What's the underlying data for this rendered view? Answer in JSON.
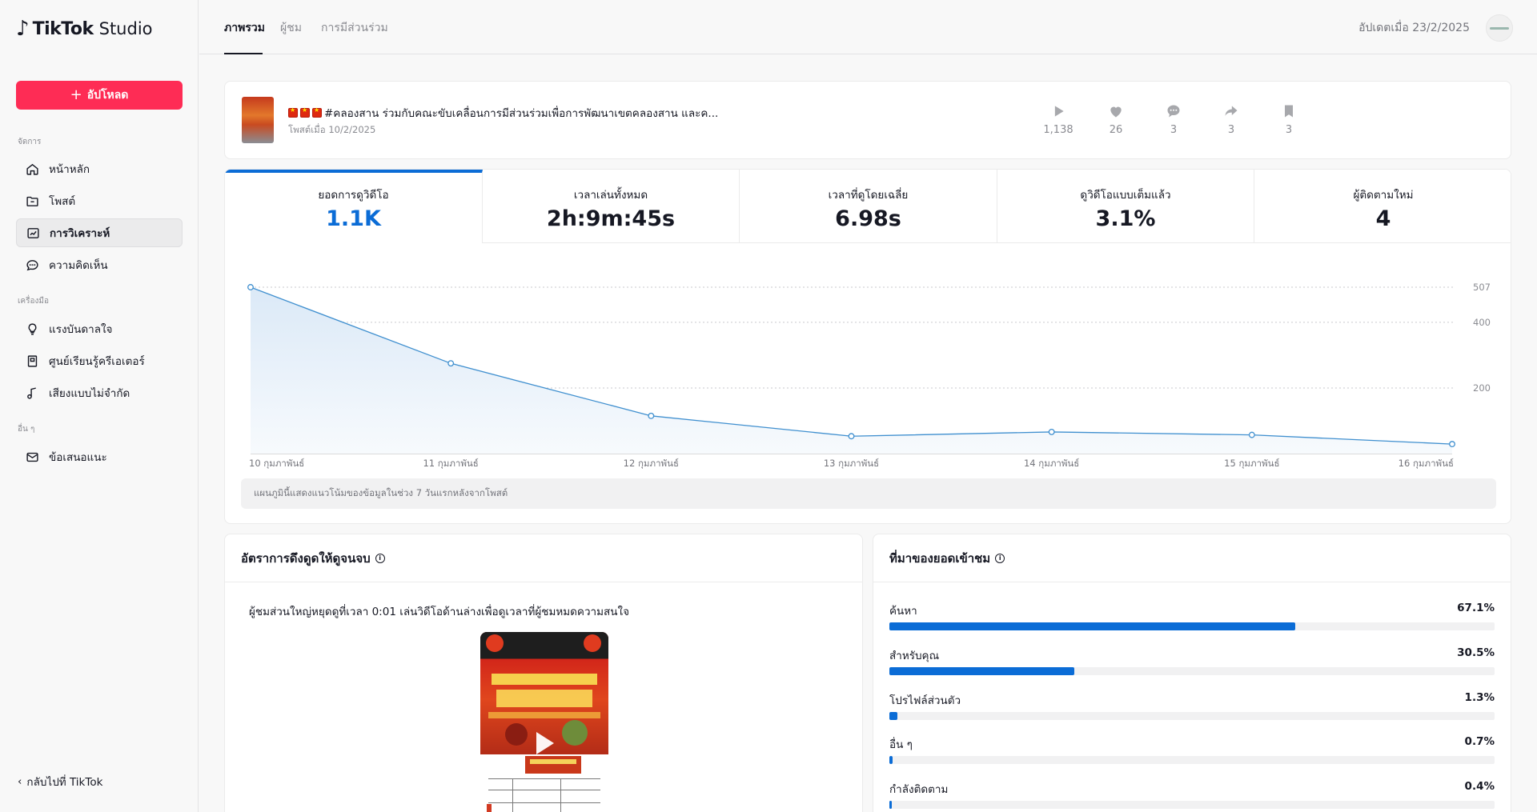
{
  "app": {
    "brand": "TikTok",
    "product": "Studio"
  },
  "sidebar": {
    "upload_label": "อัปโหลด",
    "sections": [
      "จัดการ",
      "เครื่องมือ",
      "อื่น ๆ"
    ],
    "items": [
      {
        "label": "หน้าหลัก",
        "icon": "home-icon"
      },
      {
        "label": "โพสต์",
        "icon": "folder-icon"
      },
      {
        "label": "การวิเคราะห์",
        "icon": "analytics-icon",
        "active": true
      },
      {
        "label": "ความคิดเห็น",
        "icon": "comment-icon"
      },
      {
        "label": "แรงบันดาลใจ",
        "icon": "lightbulb-icon"
      },
      {
        "label": "ศูนย์เรียนรู้ครีเอเตอร์",
        "icon": "book-icon"
      },
      {
        "label": "เสียงแบบไม่จำกัด",
        "icon": "music-note-icon"
      },
      {
        "label": "ข้อเสนอแนะ",
        "icon": "mail-icon"
      }
    ],
    "back_label": "กลับไปที่ TikTok"
  },
  "header": {
    "tabs": [
      {
        "label": "ภาพรวม",
        "active": true
      },
      {
        "label": "ผู้ชม"
      },
      {
        "label": "การมีส่วนร่วม"
      }
    ],
    "updated": "อัปเดตเมื่อ 23/2/2025"
  },
  "post": {
    "title": "#คลองสาน ร่วมกับคณะขับเคลื่อนการมีส่วนร่วมเพื่อการพัฒนาเขตคลองสาน และค...",
    "date": "โพสต์เมื่อ 10/2/2025",
    "stats": [
      {
        "icon": "play-icon",
        "value": "1,138"
      },
      {
        "icon": "heart-icon",
        "value": "26"
      },
      {
        "icon": "comment-icon",
        "value": "3"
      },
      {
        "icon": "share-icon",
        "value": "3"
      },
      {
        "icon": "bookmark-icon",
        "value": "3"
      }
    ]
  },
  "metrics": [
    {
      "label": "ยอดการดูวิดีโอ",
      "value": "1.1K",
      "active": true
    },
    {
      "label": "เวลาเล่นทั้งหมด",
      "value": "2h:9m:45s"
    },
    {
      "label": "เวลาที่ดูโดยเฉลี่ย",
      "value": "6.98s"
    },
    {
      "label": "ดูวิดีโอแบบเต็มแล้ว",
      "value": "3.1%"
    },
    {
      "label": "ผู้ติดตามใหม่",
      "value": "4"
    }
  ],
  "chart_data": {
    "type": "area",
    "categories": [
      "10 กุมภาพันธ์",
      "11 กุมภาพันธ์",
      "12 กุมภาพันธ์",
      "13 กุมภาพันธ์",
      "14 กุมภาพันธ์",
      "15 กุมภาพันธ์",
      "16 กุมภาพันธ์"
    ],
    "values": [
      507,
      275,
      115,
      53,
      66,
      57,
      29
    ],
    "y_ticks": [
      "507",
      "400",
      "200"
    ],
    "ylim": [
      0,
      507
    ],
    "grid": true,
    "y_axis_side": "right",
    "color": "#3f8fcf"
  },
  "chart_note": "แผนภูมินี้แสดงแนวโน้มของข้อมูลในช่วง 7 วันแรกหลังจากโพสต์",
  "retention": {
    "title": "อัตราการดึงดูดให้ดูจนจบ",
    "text": "ผู้ชมส่วนใหญ่หยุดดูที่เวลา 0:01 เล่นวิดีโอด้านล่างเพื่อดูเวลาที่ผู้ชมหมดความสนใจ"
  },
  "sources": {
    "title": "ที่มาของยอดเข้าชม",
    "items": [
      {
        "label": "ค้นหา",
        "value": "67.1%",
        "pct": 67.1
      },
      {
        "label": "สำหรับคุณ",
        "value": "30.5%",
        "pct": 30.5
      },
      {
        "label": "โปรไฟล์ส่วนตัว",
        "value": "1.3%",
        "pct": 1.3
      },
      {
        "label": "อื่น ๆ",
        "value": "0.7%",
        "pct": 0.7
      },
      {
        "label": "กำลังติดตาม",
        "value": "0.4%",
        "pct": 0.4
      }
    ]
  },
  "colors": {
    "accent": "#fe2c55",
    "primary_blue": "#0b6cd6",
    "chart_line": "#3f8fcf"
  }
}
